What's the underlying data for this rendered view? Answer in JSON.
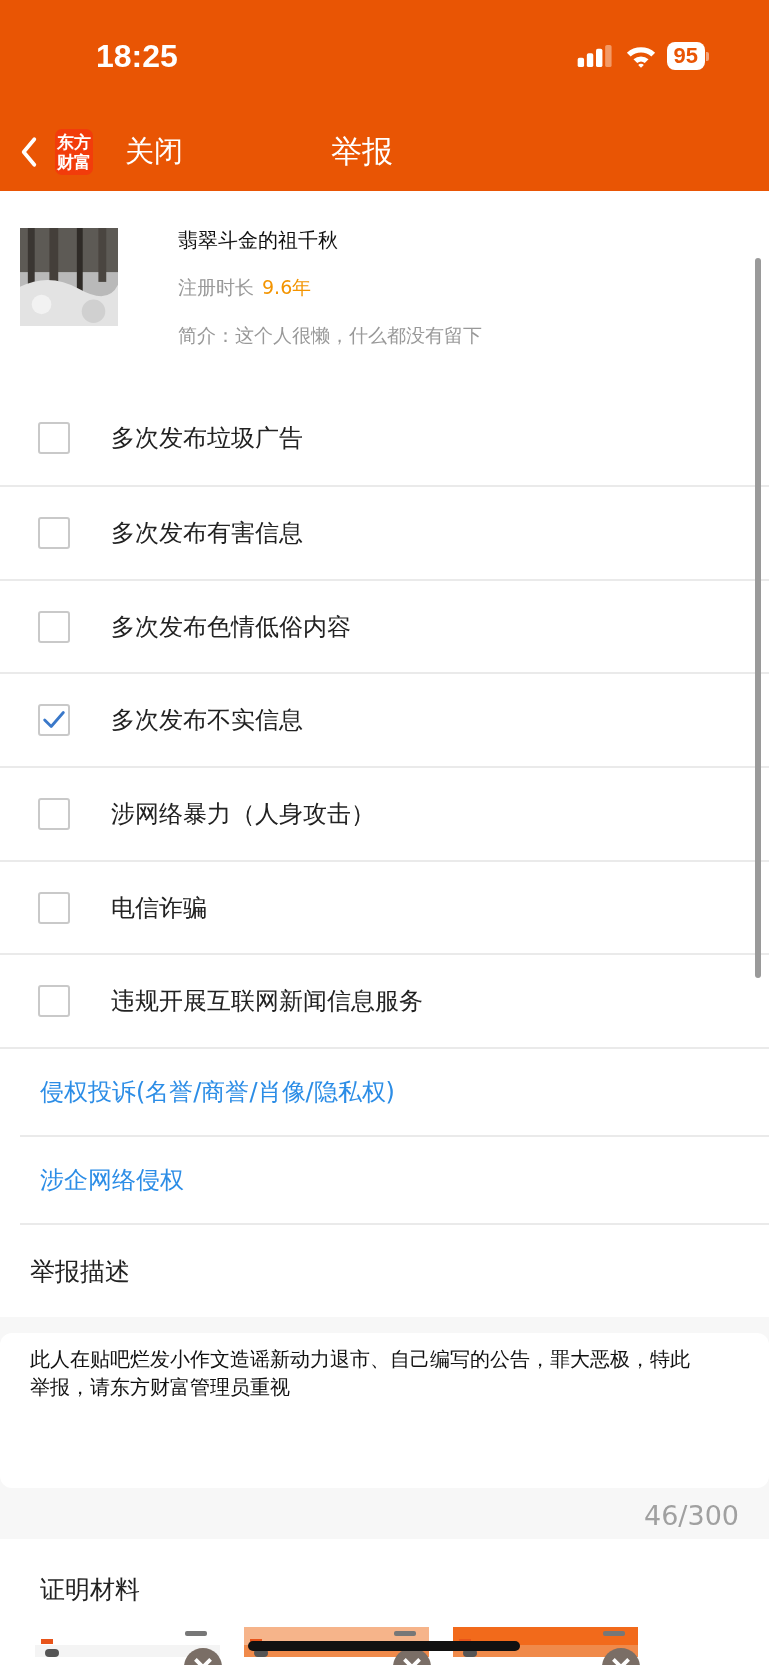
{
  "status_bar": {
    "time": "18:25",
    "battery": "95"
  },
  "nav": {
    "logo": "东方财富",
    "close": "关闭",
    "title": "举报"
  },
  "profile": {
    "name": "翡翠斗金的祖千秋",
    "reg_label": "注册时长",
    "reg_value": "9.6年",
    "bio": "简介：这个人很懒，什么都没有留下"
  },
  "reasons": [
    {
      "label": "多次发布垃圾广告",
      "checked": false
    },
    {
      "label": "多次发布有害信息",
      "checked": false
    },
    {
      "label": "多次发布色情低俗内容",
      "checked": false
    },
    {
      "label": "多次发布不实信息",
      "checked": true
    },
    {
      "label": "涉网络暴力（人身攻击）",
      "checked": false
    },
    {
      "label": "电信诈骗",
      "checked": false
    },
    {
      "label": "违规开展互联网新闻信息服务",
      "checked": false
    }
  ],
  "links": [
    "侵权投诉(名誉/商誉/肖像/隐私权)",
    "涉企网络侵权"
  ],
  "description": {
    "heading": "举报描述",
    "value": "此人在贴吧烂发小作文造谣新动力退市、自己编写的公告，罪大恶极，特此举报，请东方财富管理员重视",
    "counter": "46/300"
  },
  "evidence": {
    "heading": "证明材料"
  }
}
